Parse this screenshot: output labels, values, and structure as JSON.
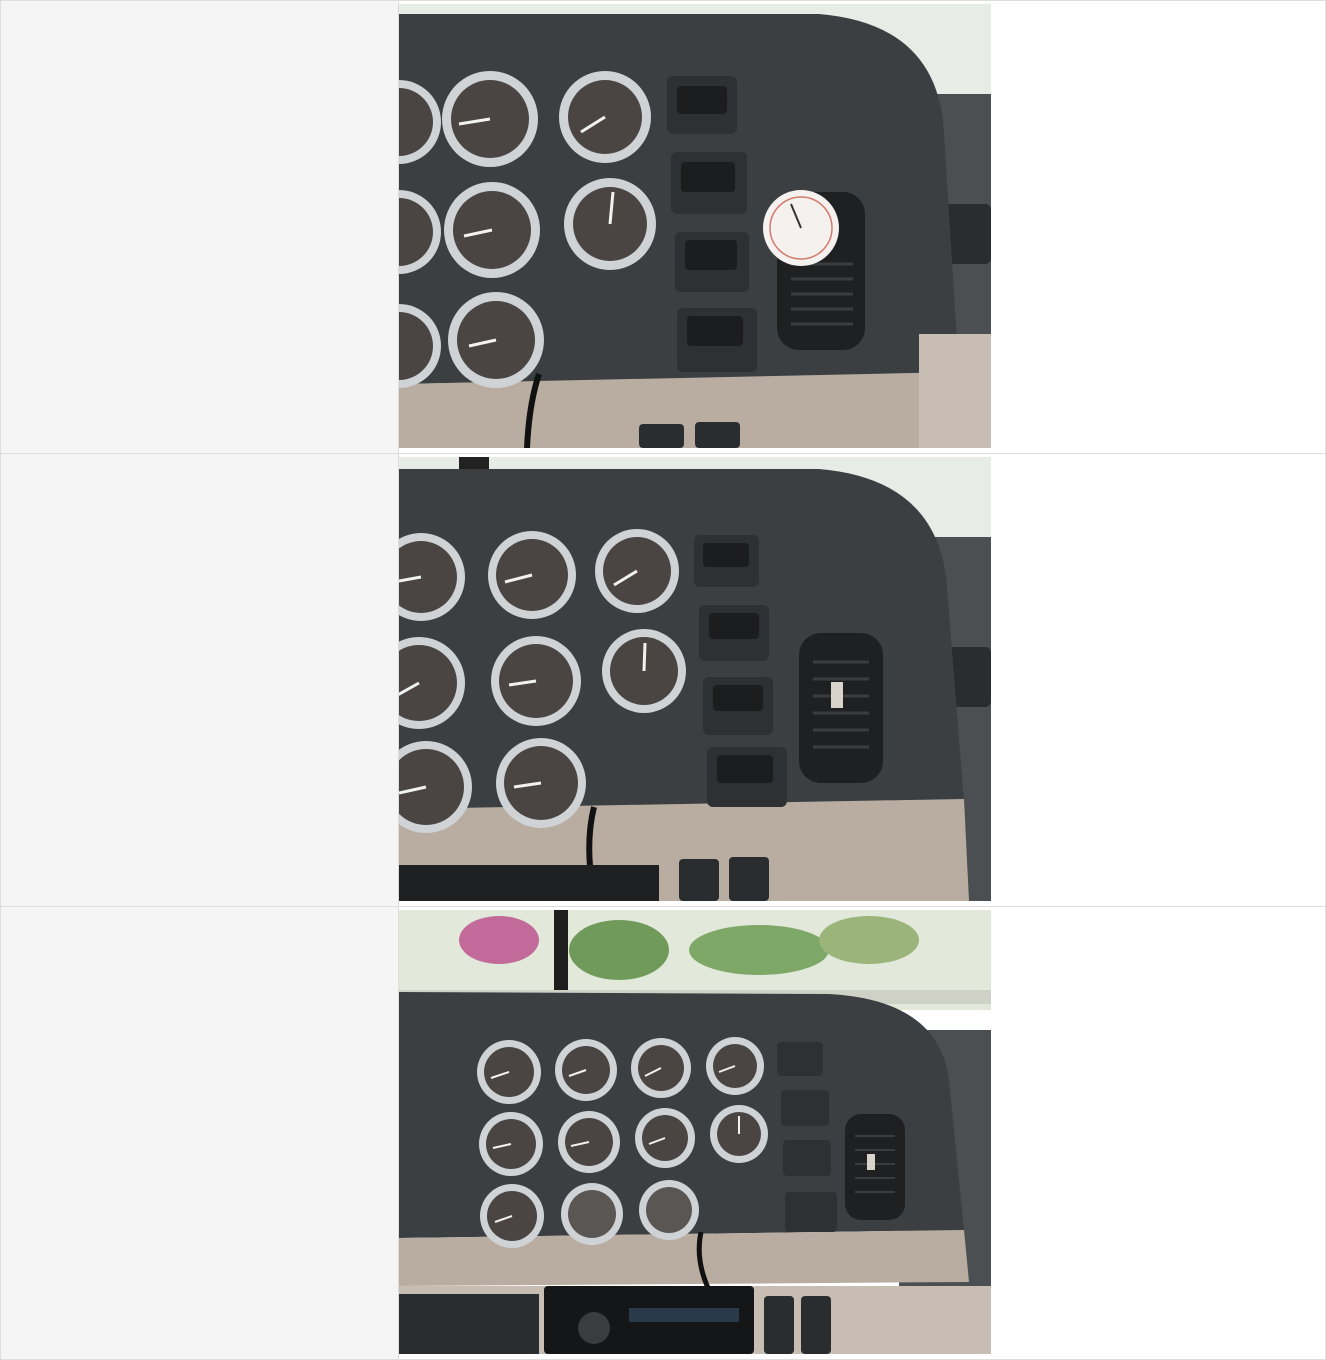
{
  "rows": [
    {
      "label": "",
      "photo": {
        "subject": "dashboard-gauges",
        "colors": {
          "panel": "#3b3f42",
          "trim": "#b9ada1",
          "bezel": "#cfd3d6",
          "face": "#4a4543",
          "sky": "#e8ece6"
        }
      }
    },
    {
      "label": "",
      "photo": {
        "subject": "dashboard-gauges",
        "colors": {
          "panel": "#3b3f42",
          "trim": "#b9ada1",
          "bezel": "#cfd3d6",
          "face": "#4a4543",
          "sky": "#e8ece6"
        }
      }
    },
    {
      "label": "",
      "photo": {
        "subject": "dashboard-gauges-wide",
        "colors": {
          "panel": "#3b3f42",
          "trim": "#b9ada1",
          "bezel": "#cfd3d6",
          "face": "#4a4543",
          "sky": "#e2e8da"
        }
      }
    }
  ]
}
